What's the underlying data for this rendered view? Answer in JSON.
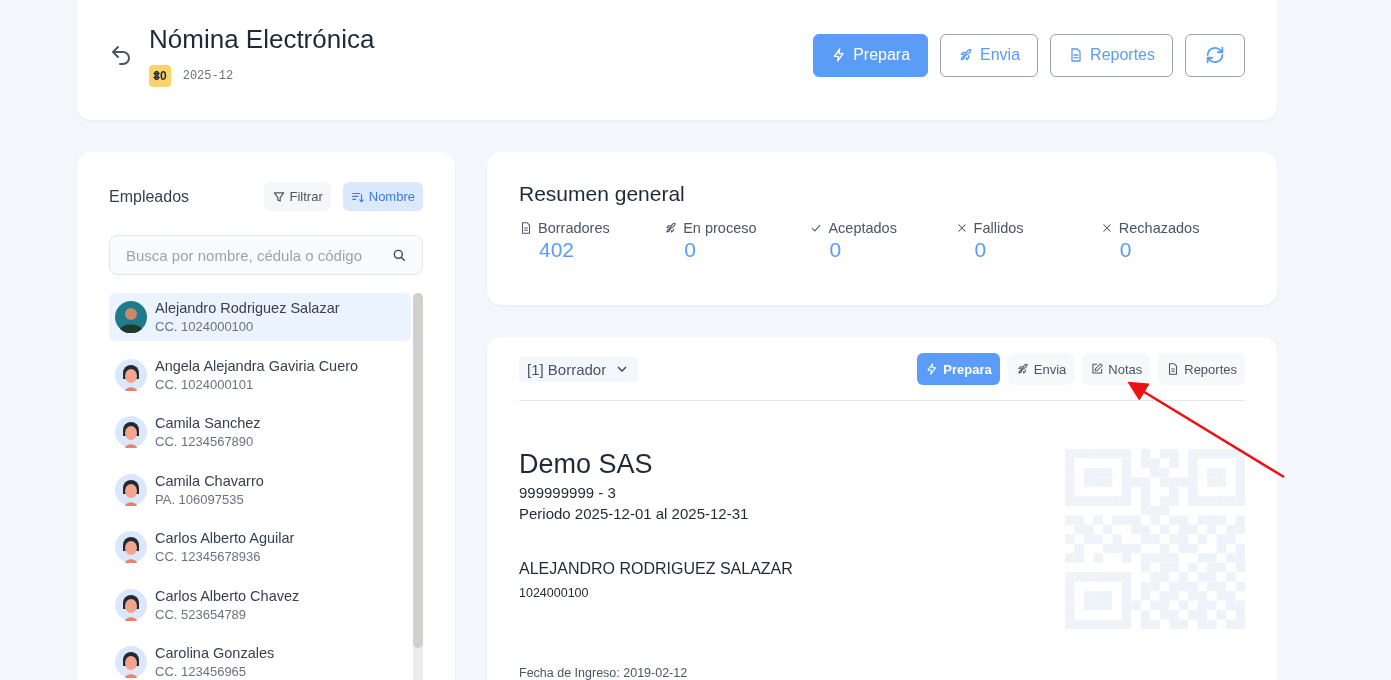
{
  "header": {
    "title": "Nómina Electrónica",
    "badge": "ꗊ0",
    "period": "2025-12",
    "buttons": [
      {
        "label": "Prepara",
        "kind": "primary"
      },
      {
        "label": "Envia",
        "kind": "outline"
      },
      {
        "label": "Reportes",
        "kind": "outline"
      },
      {
        "kind": "icon"
      }
    ]
  },
  "employees_panel": {
    "title": "Empleados",
    "filter_label": "Filtrar",
    "sort_label": "Nombre",
    "search": {
      "placeholder": "Busca por nombre, cédula o código"
    },
    "employees": [
      {
        "name": "Alejandro Rodriguez Salazar",
        "id": "CC. 1024000100",
        "selected": true,
        "kind": "photo"
      },
      {
        "name": "Angela Alejandra Gaviria Cuero",
        "id": "CC. 1024000101",
        "selected": false,
        "kind": "illustration"
      },
      {
        "name": "Camila Sanchez",
        "id": "CC. 1234567890",
        "selected": false,
        "kind": "illustration"
      },
      {
        "name": "Camila Chavarro",
        "id": "PA. 106097535",
        "selected": false,
        "kind": "illustration"
      },
      {
        "name": "Carlos Alberto Aguilar",
        "id": "CC. 12345678936",
        "selected": false,
        "kind": "illustration"
      },
      {
        "name": "Carlos Alberto Chavez",
        "id": "CC. 523654789",
        "selected": false,
        "kind": "illustration"
      },
      {
        "name": "Carolina Gonzales",
        "id": "CC. 123456965",
        "selected": false,
        "kind": "illustration"
      }
    ]
  },
  "summary": {
    "title": "Resumen general",
    "stats": [
      {
        "label": "Borradores",
        "value": "402"
      },
      {
        "label": "En proceso",
        "value": "0"
      },
      {
        "label": "Aceptados",
        "value": "0"
      },
      {
        "label": "Fallidos",
        "value": "0"
      },
      {
        "label": "Rechazados",
        "value": "0"
      }
    ]
  },
  "document": {
    "status_select": "[1] Borrador",
    "actions": [
      {
        "label": "Prepara",
        "kind": "primary"
      },
      {
        "label": "Envia",
        "kind": "soft"
      },
      {
        "label": "Notas",
        "kind": "soft"
      },
      {
        "label": "Reportes",
        "kind": "soft"
      }
    ],
    "company": "Demo SAS",
    "nit": "999999999 - 3",
    "period": "Periodo 2025-12-01 al 2025-12-31",
    "employee_name": "ALEJANDRO RODRIGUEZ SALAZAR",
    "employee_id": "1024000100",
    "hire_date": "Fecha de Ingreso: 2019-02-12"
  }
}
